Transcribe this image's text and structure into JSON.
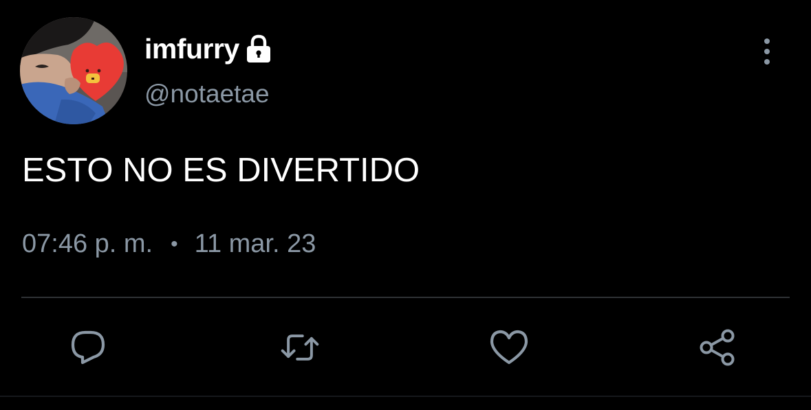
{
  "tweet": {
    "author": {
      "display_name": "imfurry",
      "handle": "@notaetae",
      "protected_icon": "lock-icon",
      "avatar": "avatar-photo"
    },
    "text": "ESTO NO ES DIVERTIDO",
    "time": "07:46 p. m.",
    "separator": "•",
    "date": "11 mar. 23"
  },
  "actions": [
    {
      "icon": "reply-icon"
    },
    {
      "icon": "retweet-icon"
    },
    {
      "icon": "like-icon"
    },
    {
      "icon": "share-icon"
    }
  ],
  "menu": {
    "icon": "more-vertical-icon"
  },
  "colors": {
    "background": "#000000",
    "primary_text": "#ffffff",
    "secondary_text": "#8b98a5",
    "icon": "#8b98a5",
    "divider": "#2f3336"
  }
}
